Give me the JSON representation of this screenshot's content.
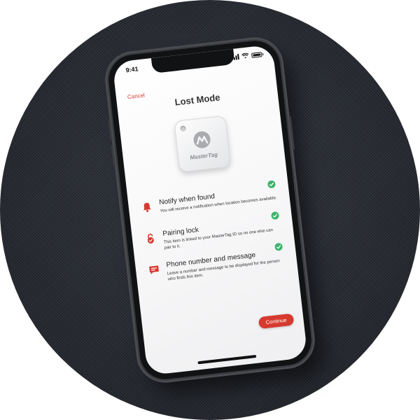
{
  "status_bar": {
    "time": "9:41"
  },
  "header": {
    "cancel_label": "Cancel",
    "title": "Lost Mode"
  },
  "tag": {
    "brand": "MasterTag"
  },
  "features": [
    {
      "icon": "bell-icon",
      "title": "Notify when found",
      "description": "You will receive a notification when location becomes available."
    },
    {
      "icon": "lock-icon",
      "title": "Pairing lock",
      "description": "This item is linked to your MasterTag ID so no one else can pair to it."
    },
    {
      "icon": "message-icon",
      "title": "Phone number and message",
      "description": "Leave a number and message to be displayed for the person who finds this item."
    }
  ],
  "footer": {
    "continue_label": "Continue"
  },
  "colors": {
    "accent": "#d63a2f",
    "check": "#3db36a",
    "background_fabric": "#2a2d35"
  }
}
